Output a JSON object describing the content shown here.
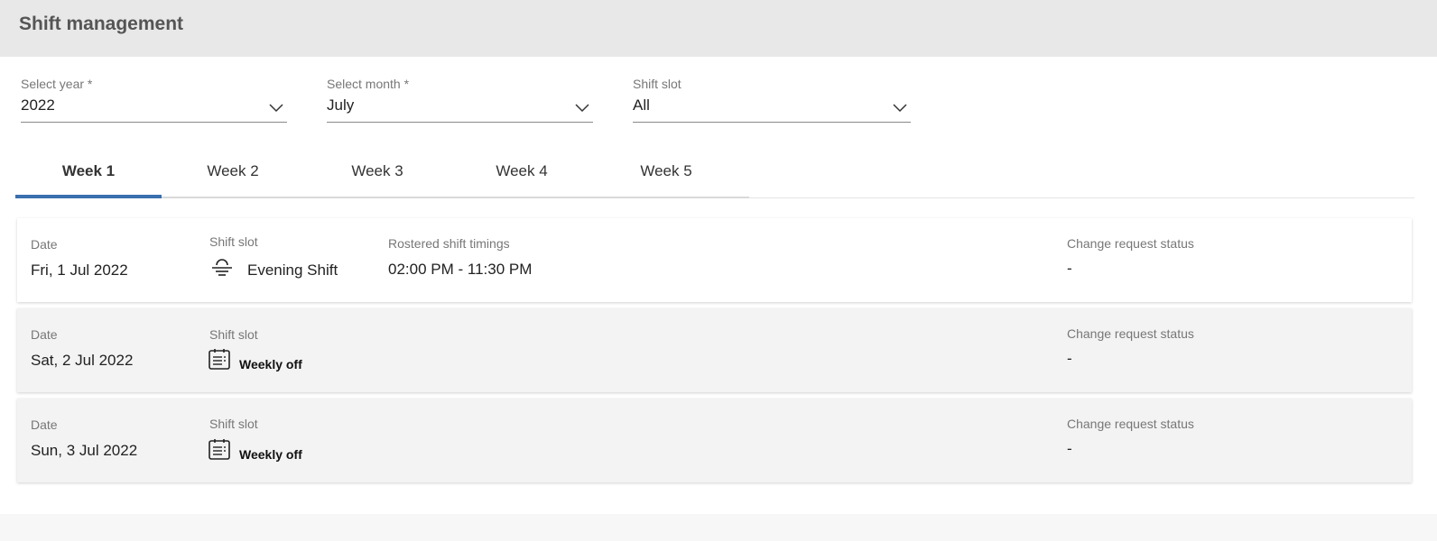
{
  "header": {
    "title": "Shift management"
  },
  "filters": {
    "year": {
      "label": "Select year *",
      "value": "2022"
    },
    "month": {
      "label": "Select month *",
      "value": "July"
    },
    "slot": {
      "label": "Shift slot",
      "value": "All"
    }
  },
  "tabs": [
    {
      "label": "Week 1",
      "active": true
    },
    {
      "label": "Week 2",
      "active": false
    },
    {
      "label": "Week 3",
      "active": false
    },
    {
      "label": "Week 4",
      "active": false
    },
    {
      "label": "Week 5",
      "active": false
    }
  ],
  "accent_color": "#3a6fb0",
  "rows": [
    {
      "date_label": "Date",
      "date": "Fri, 1 Jul 2022",
      "slot_label": "Shift slot",
      "slot_icon": "sunset-icon",
      "slot_value": "Evening Shift",
      "timing_label": "Rostered shift timings",
      "timing_value": "02:00 PM - 11:30 PM",
      "status_label": "Change request status",
      "status_value": "-"
    },
    {
      "date_label": "Date",
      "date": "Sat, 2 Jul 2022",
      "slot_label": "Shift slot",
      "slot_icon": "calendar-icon",
      "slot_value": "Weekly off",
      "status_label": "Change request status",
      "status_value": "-"
    },
    {
      "date_label": "Date",
      "date": "Sun, 3 Jul 2022",
      "slot_label": "Shift slot",
      "slot_icon": "calendar-icon",
      "slot_value": "Weekly off",
      "status_label": "Change request status",
      "status_value": "-"
    }
  ]
}
